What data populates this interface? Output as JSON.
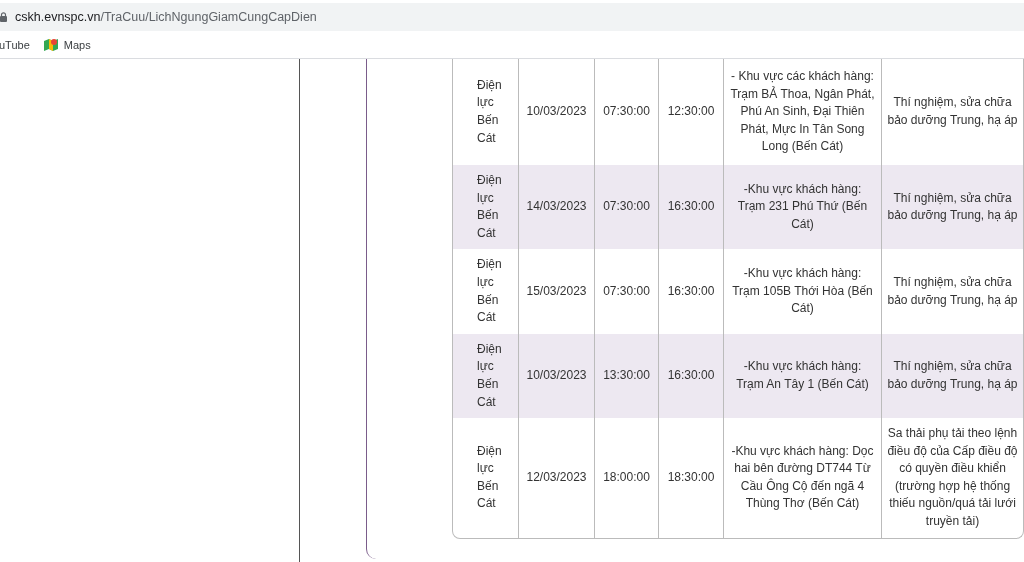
{
  "address_bar": {
    "url_host": "cskh.evnspc.vn",
    "url_path": "/TraCuu/LichNgungGiamCungCapDien"
  },
  "bookmarks": [
    {
      "label": "uTube",
      "kind": "youtube"
    },
    {
      "label": "Maps",
      "kind": "maps"
    }
  ],
  "table": {
    "rows": [
      {
        "unit": "Điện lực Bến Cát",
        "date": "10/03/2023",
        "start": "07:30:00",
        "end": "12:30:00",
        "area": "- Khu vực các khách hàng: Trạm BẢ Thoa, Ngân Phát, Phú An Sinh, Đại Thiên Phát, Mực In Tân Song Long (Bến Cát)",
        "reason": "Thí nghiệm, sửa chữa bảo dưỡng Trung, hạ áp"
      },
      {
        "unit": "Điện lực Bến Cát",
        "date": "14/03/2023",
        "start": "07:30:00",
        "end": "16:30:00",
        "area": "-Khu vực khách hàng: Trạm 231 Phú Thứ (Bến Cát)",
        "reason": "Thí nghiệm, sửa chữa bảo dưỡng Trung, hạ áp"
      },
      {
        "unit": "Điện lực Bến Cát",
        "date": "15/03/2023",
        "start": "07:30:00",
        "end": "16:30:00",
        "area": "-Khu vực khách hàng: Trạm 105B Thới Hòa (Bến Cát)",
        "reason": "Thí nghiệm, sửa chữa bảo dưỡng Trung, hạ áp"
      },
      {
        "unit": "Điện lực Bến Cát",
        "date": "10/03/2023",
        "start": "13:30:00",
        "end": "16:30:00",
        "area": "-Khu vực khách hàng: Trạm An Tây 1 (Bến Cát)",
        "reason": "Thí nghiệm, sửa chữa bảo dưỡng Trung, hạ áp"
      },
      {
        "unit": "Điện lực Bến Cát",
        "date": "12/03/2023",
        "start": "18:00:00",
        "end": "18:30:00",
        "area": "-Khu vực khách hàng: Dọc hai bên đường DT744 Từ Cầu Ông Cộ đến ngã 4 Thùng Thơ (Bến Cát)",
        "reason": "Sa thải phụ tải theo lệnh điều độ của Cấp điều độ có quyền điều khiển (trường hợp hệ thống thiếu nguồn/quá tải lưới truyền tải)"
      }
    ]
  }
}
